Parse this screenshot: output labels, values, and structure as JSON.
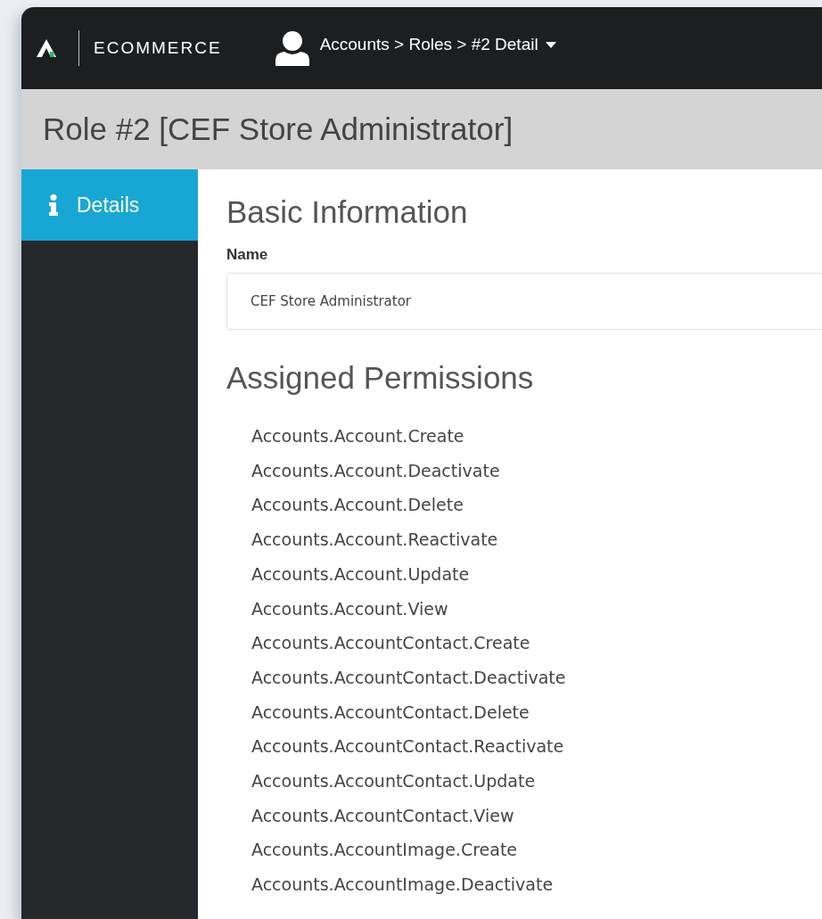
{
  "top_bar": {
    "brand": "ECOMMERCE",
    "breadcrumb": "Accounts > Roles > #2 Detail"
  },
  "page_title": "Role #2 [CEF Store Administrator]",
  "sidebar": {
    "items": [
      {
        "label": "Details",
        "selected": true
      }
    ]
  },
  "basic_information": {
    "heading": "Basic Information",
    "name_label": "Name",
    "name_value": "CEF Store Administrator"
  },
  "assigned_permissions": {
    "heading": "Assigned Permissions",
    "items": [
      "Accounts.Account.Create",
      "Accounts.Account.Deactivate",
      "Accounts.Account.Delete",
      "Accounts.Account.Reactivate",
      "Accounts.Account.Update",
      "Accounts.Account.View",
      "Accounts.AccountContact.Create",
      "Accounts.AccountContact.Deactivate",
      "Accounts.AccountContact.Delete",
      "Accounts.AccountContact.Reactivate",
      "Accounts.AccountContact.Update",
      "Accounts.AccountContact.View",
      "Accounts.AccountImage.Create",
      "Accounts.AccountImage.Deactivate"
    ]
  }
}
